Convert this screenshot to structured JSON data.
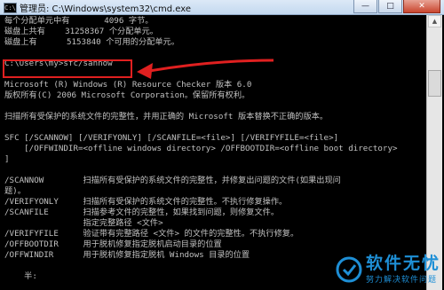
{
  "window": {
    "title": "管理员: C:\\Windows\\system32\\cmd.exe",
    "icon_label": "C:\\",
    "minimize": "—",
    "maximize": "□",
    "close": "✕"
  },
  "console": {
    "lines": [
      "每个分配单元中有       4096 字节。",
      "磁盘上共有    31258367 个分配单元。",
      "磁盘上有      5153840 个可用的分配单元。",
      "",
      "C:\\Users\\my>sfc/sannow",
      "",
      "Microsoft (R) Windows (R) Resource Checker 版本 6.0",
      "版权所有(C) 2006 Microsoft Corporation。保留所有权利。",
      "",
      "扫描所有受保护的系统文件的完整性，并用正确的 Microsoft 版本替换不正确的版本。",
      "",
      "SFC [/SCANNOW] [/VERIFYONLY] [/SCANFILE=<file>] [/VERIFYFILE=<file>]",
      "    [/OFFWINDIR=<offline windows directory> /OFFBOOTDIR=<offline boot directory>",
      "]",
      "",
      "/SCANNOW        扫描所有受保护的系统文件的完整性，并修复出问题的文件(如果出现问",
      "题)。",
      "/VERIFYONLY     扫描所有受保护的系统文件的完整性。不执行修复操作。",
      "/SCANFILE       扫描参考文件的完整性，如果找到问题，则修复文件。",
      "                指定完整路径 <文件>",
      "/VERIFYFILE     验证带有完整路径 <文件> 的文件的完整性。不执行修复。",
      "/OFFBOOTDIR     用于脱机修复指定脱机启动目录的位置",
      "/OFFWINDIR      用于脱机修复指定脱机 Windows 目录的位置",
      "",
      "    半:"
    ]
  },
  "scrollbar": {
    "up_arrow": "▲"
  },
  "watermark": {
    "main": "软件无忧",
    "sub": "努力解决软件问题"
  },
  "colors": {
    "console_bg": "#000000",
    "console_text": "#c0c0c0",
    "highlight": "#e02020",
    "watermark": "#1e8fd6"
  }
}
